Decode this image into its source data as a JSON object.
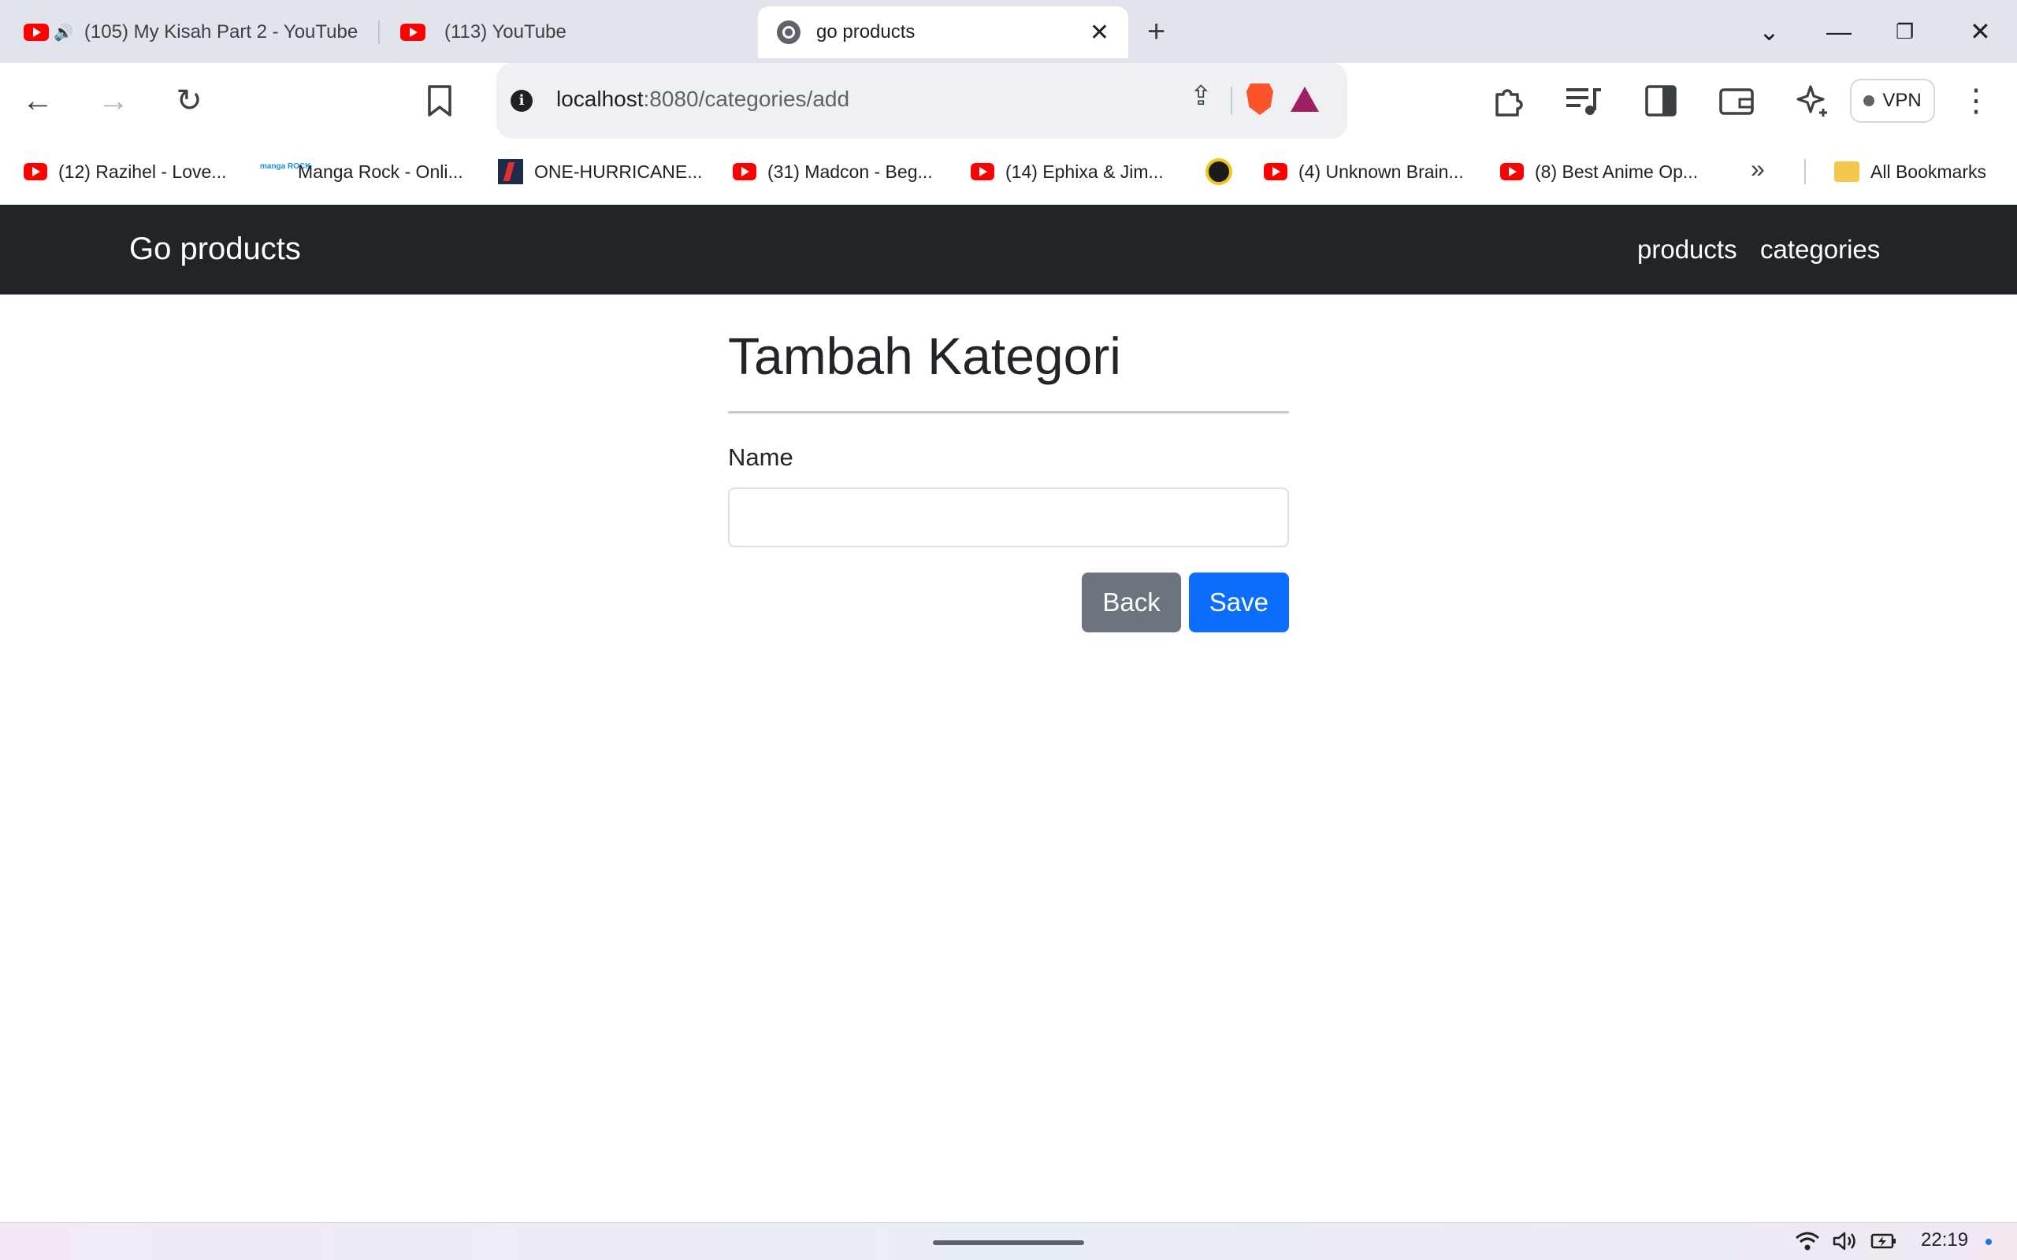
{
  "browser": {
    "tabs": [
      {
        "title": "(105) My Kisah Part 2 - YouTube",
        "icon": "youtube-icon",
        "audio": true
      },
      {
        "title": "(113) YouTube",
        "icon": "youtube-icon"
      },
      {
        "title": "go products",
        "icon": "globe-icon",
        "active": true
      }
    ],
    "url_host": "localhost",
    "url_rest": ":8080/categories/add",
    "vpn_label": "VPN",
    "bookmarks": [
      {
        "label": "(12) Razihel - Love...",
        "icon": "youtube-icon"
      },
      {
        "label": "Manga Rock - Onli...",
        "icon": "manga-rock-icon"
      },
      {
        "label": "ONE-HURRICANE...",
        "icon": "one-hurricane-icon"
      },
      {
        "label": "(31) Madcon - Beg...",
        "icon": "youtube-icon"
      },
      {
        "label": "(14) Ephixa & Jim...",
        "icon": "youtube-icon"
      },
      {
        "label": "",
        "icon": "pathfinder-logo-icon"
      },
      {
        "label": "(4) Unknown Brain...",
        "icon": "youtube-icon"
      },
      {
        "label": "(8) Best Anime Op...",
        "icon": "youtube-icon"
      }
    ],
    "all_bookmarks_label": "All Bookmarks",
    "manga_rock_logo": "manga ROCK"
  },
  "navbar": {
    "brand": "Go products",
    "links": [
      "products",
      "categories"
    ]
  },
  "form": {
    "title": "Tambah Kategori",
    "name_label": "Name",
    "name_value": "",
    "back_label": "Back",
    "save_label": "Save"
  },
  "system": {
    "time": "22:19"
  },
  "colors": {
    "navbar_bg": "#212529",
    "back_button": "#6c757d",
    "save_button": "#0d6efd"
  }
}
